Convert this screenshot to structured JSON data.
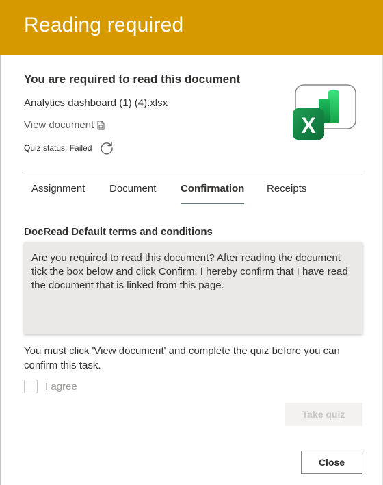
{
  "header": {
    "title": "Reading required"
  },
  "document": {
    "heading": "You are required to read this document",
    "name": "Analytics dashboard (1) (4).xlsx",
    "view_link": "View document",
    "quiz_status": "Quiz status: Failed",
    "file_icon": "excel-icon"
  },
  "tabs": [
    {
      "label": "Assignment",
      "active": false
    },
    {
      "label": "Document",
      "active": false
    },
    {
      "label": "Confirmation",
      "active": true
    },
    {
      "label": "Receipts",
      "active": false
    }
  ],
  "terms": {
    "title": "DocRead Default terms and conditions",
    "body": "Are you required to read this document? After reading the document tick the box below and click Confirm. I hereby confirm that I have read the document that is linked from this page."
  },
  "notice": "You must click 'View document' and complete the quiz before you can confirm this task.",
  "agree": {
    "label": "I agree",
    "checked": false,
    "disabled": true
  },
  "buttons": {
    "take_quiz": "Take quiz",
    "close": "Close"
  },
  "colors": {
    "header_bg": "#d69a00",
    "header_text": "#ffffff",
    "tab_underline": "#6a7a7a",
    "terms_bg": "#ebe9e7"
  }
}
